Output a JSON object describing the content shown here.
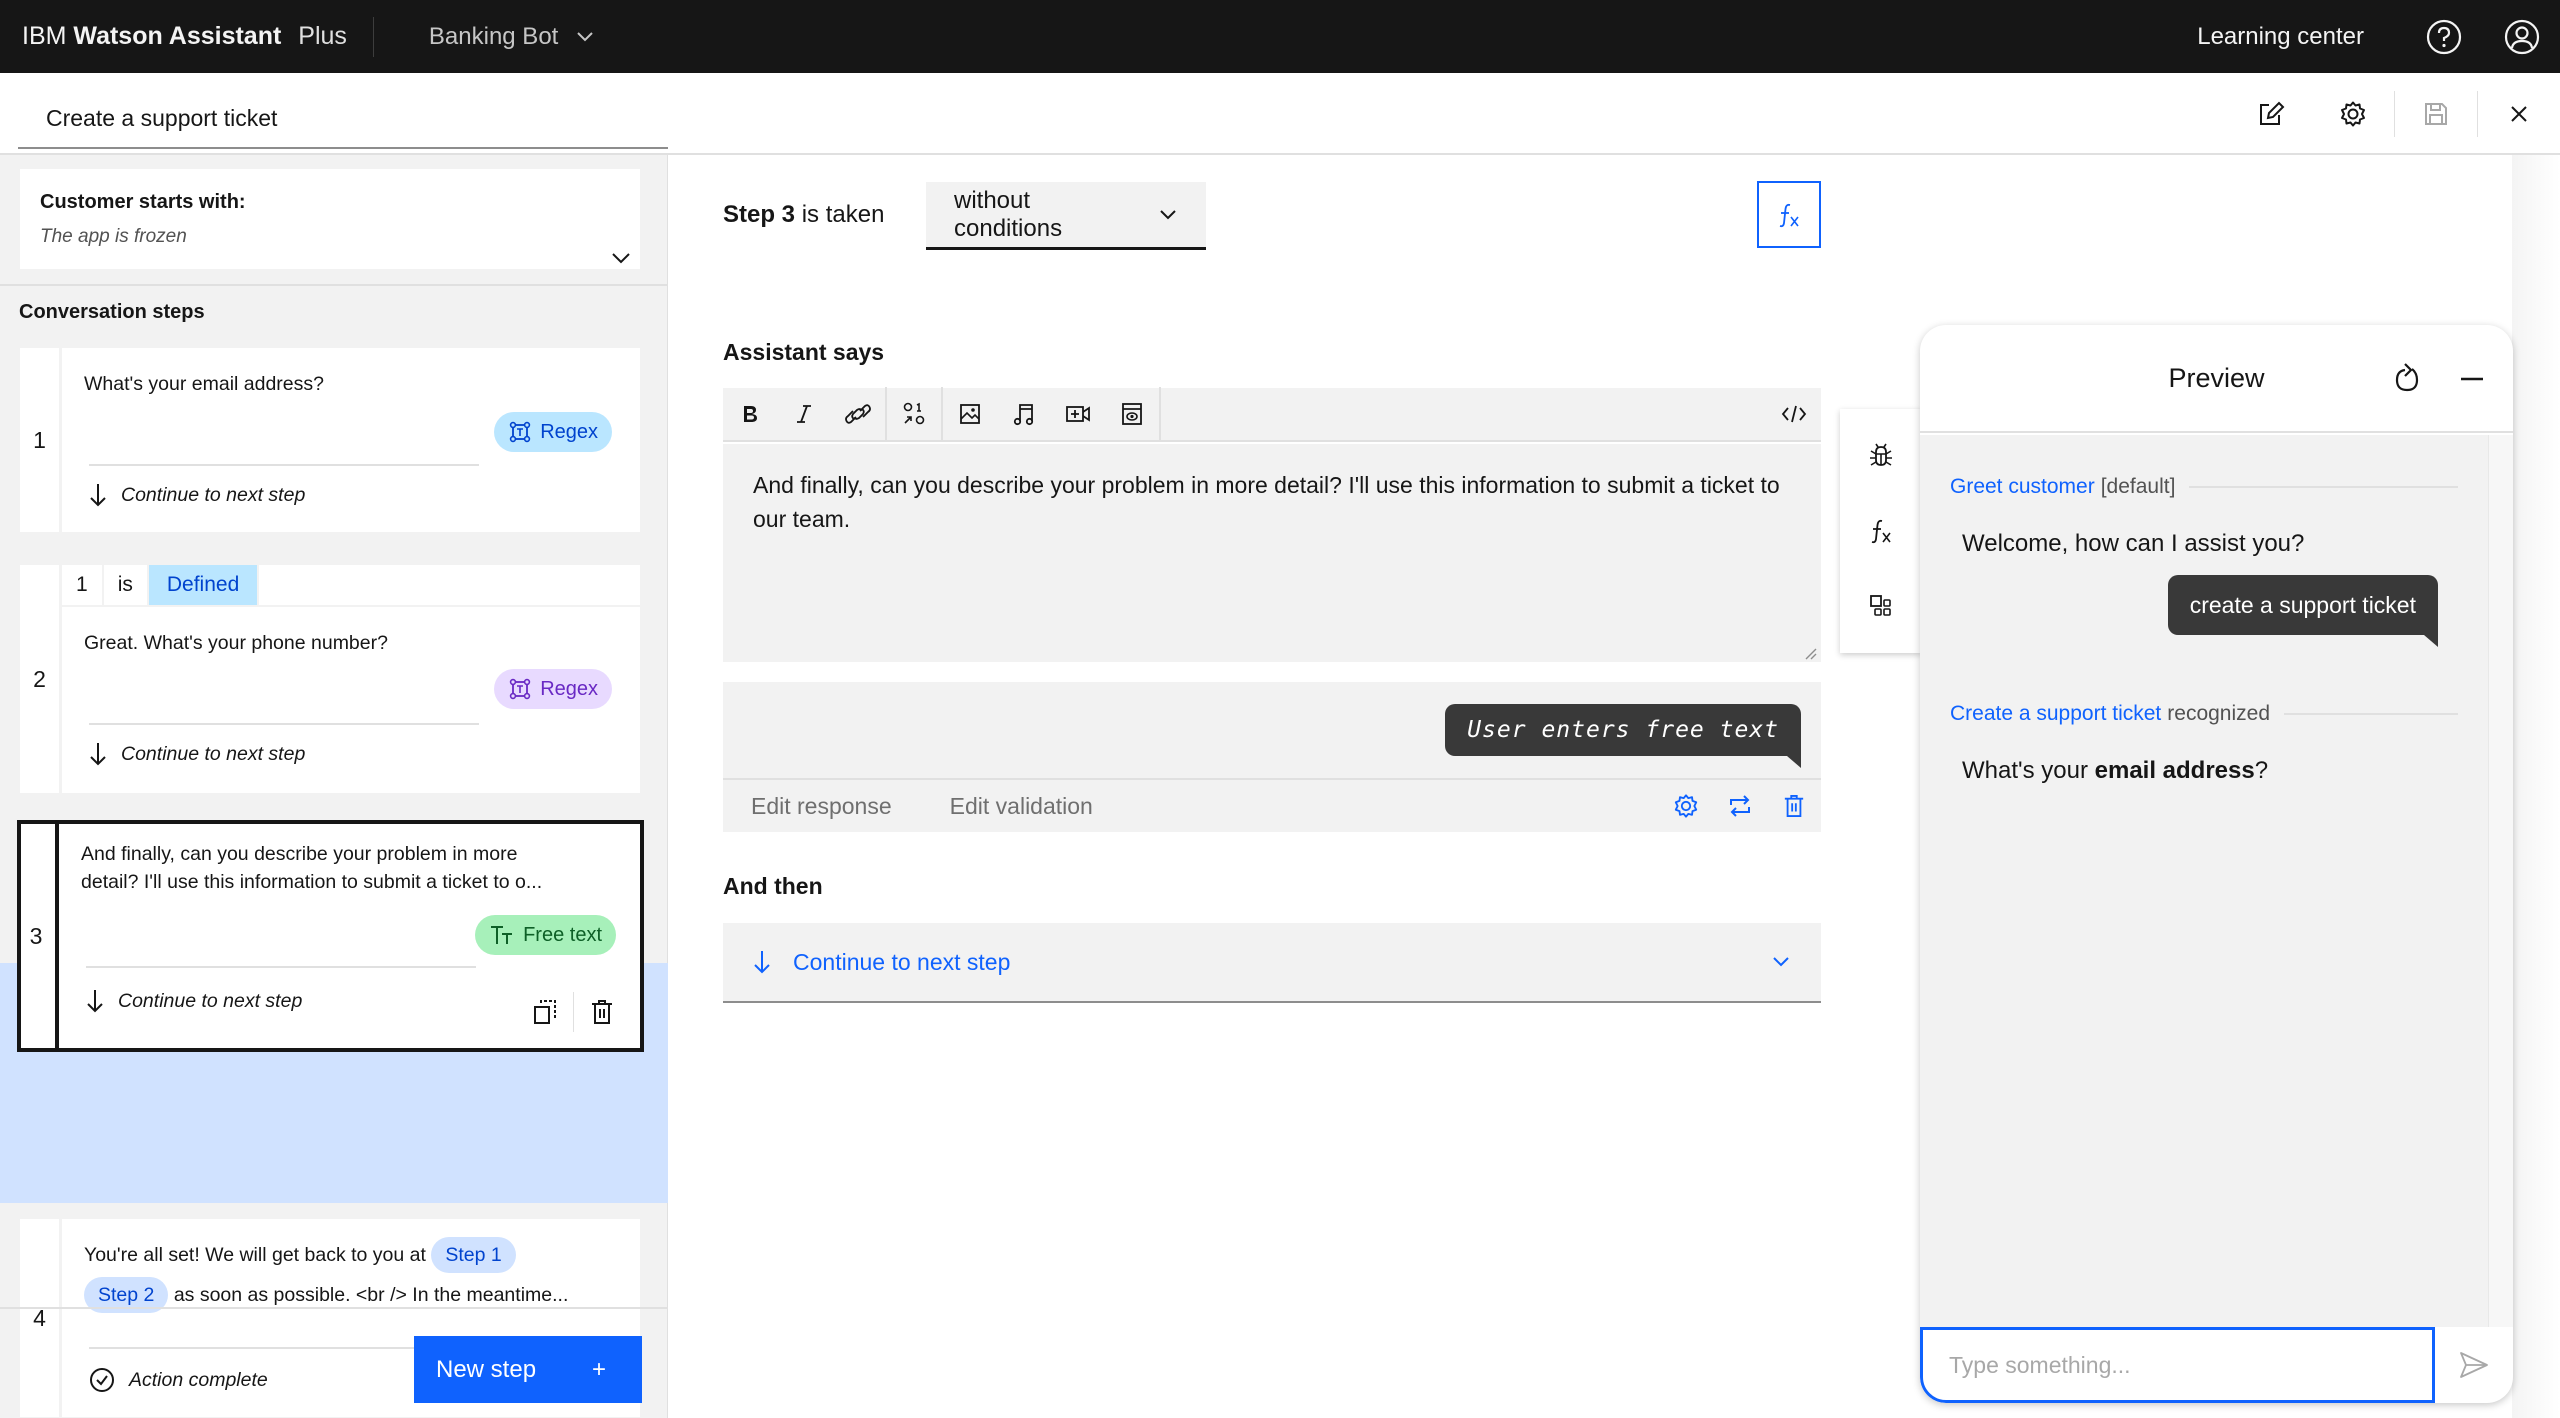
{
  "header": {
    "brand_prefix": "IBM",
    "brand_name": "Watson Assistant",
    "plan": "Plus",
    "assistant_selector": "Banking Bot",
    "learning_center": "Learning center"
  },
  "subheader": {
    "action_name": "Create a support ticket"
  },
  "left_panel": {
    "customer_starts_label": "Customer starts with:",
    "customer_starts_value": "The app is frozen",
    "conversation_steps_title": "Conversation steps",
    "steps": [
      {
        "number": "1",
        "message": "What's your email address?",
        "chip": "Regex",
        "next": "Continue to next step"
      },
      {
        "number": "2",
        "condition": {
          "variable": "1",
          "operator": "is",
          "value": "Defined"
        },
        "message": "Great. What's your phone number?",
        "chip": "Regex",
        "next": "Continue to next step"
      },
      {
        "number": "3",
        "message_line1": "And finally, can you describe your problem in more",
        "message_line2": "detail? I'll use this information to submit a ticket to o...",
        "chip": "Free text",
        "next": "Continue to next step",
        "selected": true
      },
      {
        "number": "4",
        "message_part1": "You're all set! We will get back to you at",
        "ref1": "Step 1",
        "ref2": "Step 2",
        "message_part2": "as soon as possible. <br /> In the meantime...",
        "next": "Action complete"
      }
    ],
    "new_step_label": "New step",
    "new_step_icon": "+"
  },
  "editor": {
    "step_label": "Step 3",
    "is_taken": "is taken",
    "condition_select": "without conditions",
    "assistant_says_title": "Assistant says",
    "toolbar": [
      "bold",
      "italic",
      "link",
      "variable",
      "image",
      "audio",
      "video",
      "iframe",
      "code"
    ],
    "assistant_text": "And finally, can you describe your problem in more detail? I'll use this information to submit a ticket to our team.",
    "response_bubble": "User enters free text",
    "edit_response": "Edit response",
    "edit_validation": "Edit validation",
    "and_then_title": "And then",
    "and_then_value": "Continue to next step"
  },
  "preview": {
    "title": "Preview",
    "greet_link": "Greet customer",
    "greet_meta": "[default]",
    "welcome": "Welcome, how can I assist you?",
    "user_message": "create a support ticket",
    "recognized_link": "Create a support ticket",
    "recognized_meta": "recognized",
    "bot_question_prefix": "What's your ",
    "bot_question_bold": "email address",
    "bot_question_suffix": "?",
    "input_placeholder": "Type something..."
  },
  "colors": {
    "accent": "#0f62fe",
    "header_bg": "#161616",
    "selected_step_bg": "#d0e2ff",
    "regex_blue_chip": "#bae6ff",
    "regex_purple_chip": "#e8daff",
    "free_text_chip": "#a7f0ba"
  }
}
